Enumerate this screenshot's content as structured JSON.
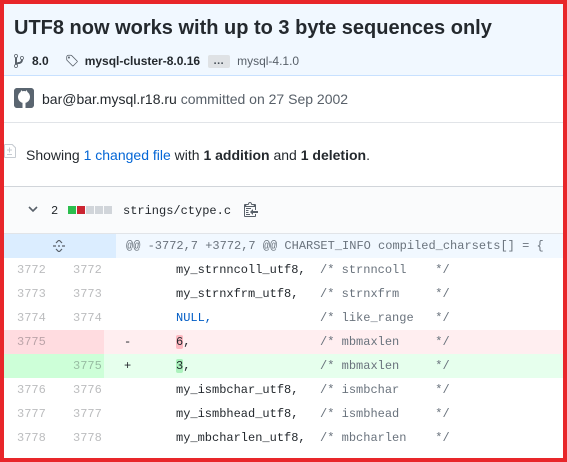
{
  "commit": {
    "title": "UTF8 now works with up to 3 byte sequences only",
    "branch": "8.0",
    "tag": "mysql-cluster-8.0.16",
    "ellipsis": "…",
    "tag_last": "mysql-4.1.0"
  },
  "meta": {
    "author": "bar@bar.mysql.r18.ru",
    "committed_on": "committed on 27 Sep 2002"
  },
  "toc": {
    "showing": "Showing",
    "changed": "1 changed file",
    "with": "with",
    "additions": "1 addition",
    "and": "and",
    "deletions": "1 deletion",
    "period": "."
  },
  "file": {
    "changes": "2",
    "name": "strings/ctype.c",
    "diffstat_colors": [
      "#2cbe4e",
      "#cb2431",
      "#d1d5da",
      "#d1d5da",
      "#d1d5da"
    ]
  },
  "diff": {
    "hunk_header": "@@ -3772,7 +3772,7 @@ CHARSET_INFO compiled_charsets[] = {",
    "rows": [
      {
        "old": "3772",
        "new": "3772",
        "sign": "",
        "code": "my_strnncoll_utf8,",
        "comment": "/* strnncoll    */"
      },
      {
        "old": "3773",
        "new": "3773",
        "sign": "",
        "code": "my_strnxfrm_utf8,",
        "comment": "/* strnxfrm     */"
      },
      {
        "old": "3774",
        "new": "3774",
        "sign": "",
        "code": "NULL,",
        "comment": "/* like_range   */"
      },
      {
        "old": "3775",
        "new": "",
        "sign": "-",
        "code_hl": "6",
        "code_rest": ",",
        "comment": "/* mbmaxlen     */"
      },
      {
        "old": "",
        "new": "3775",
        "sign": "+",
        "code_hl": "3",
        "code_rest": ",",
        "comment": "/* mbmaxlen     */"
      },
      {
        "old": "3776",
        "new": "3776",
        "sign": "",
        "code": "my_ismbchar_utf8,",
        "comment": "/* ismbchar     */"
      },
      {
        "old": "3777",
        "new": "3777",
        "sign": "",
        "code": "my_ismbhead_utf8,",
        "comment": "/* ismbhead     */"
      },
      {
        "old": "3778",
        "new": "3778",
        "sign": "",
        "code": "my_mbcharlen_utf8,",
        "comment": "/* mbcharlen    */"
      }
    ]
  }
}
